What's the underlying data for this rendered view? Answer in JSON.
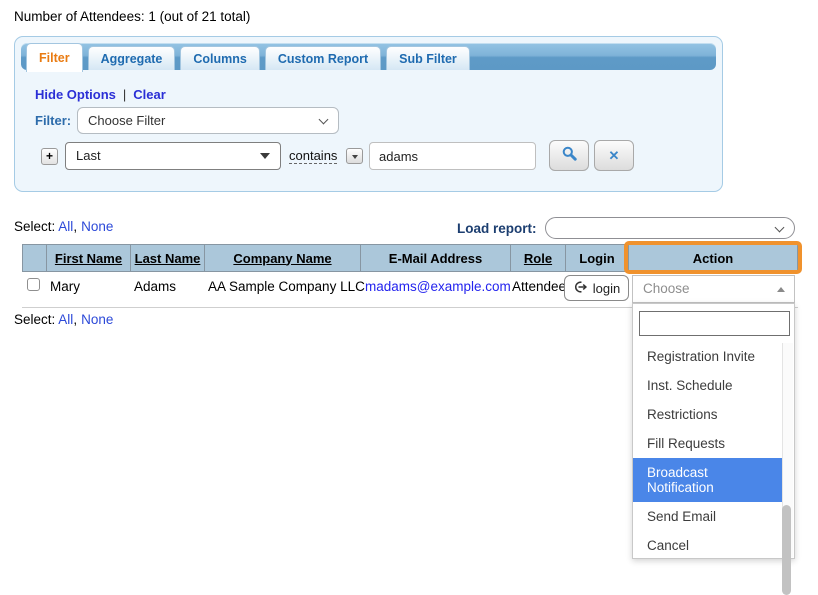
{
  "page": {
    "title": "Number of Attendees: 1 (out of 21 total)"
  },
  "filter_panel": {
    "tabs": [
      {
        "label": "Filter",
        "active": true
      },
      {
        "label": "Aggregate",
        "active": false
      },
      {
        "label": "Columns",
        "active": false
      },
      {
        "label": "Custom Report",
        "active": false
      },
      {
        "label": "Sub Filter",
        "active": false
      }
    ],
    "hide_options_label": "Hide Options",
    "links_separator": "|",
    "clear_label": "Clear",
    "filter_label": "Filter:",
    "filter_select_value": "Choose Filter",
    "condition_row": {
      "add_button_glyph": "+",
      "field_select_value": "Last",
      "operator_value": "contains",
      "search_input_value": "adams",
      "search_button_icon": "magnifier-icon",
      "clear_button_icon": "x-icon",
      "clear_button_glyph": "✕"
    }
  },
  "select_bar_top": {
    "label": "Select:",
    "all_label": "All",
    "comma": ",",
    "none_label": "None"
  },
  "load_report": {
    "label": "Load report:",
    "selected_value": ""
  },
  "table": {
    "headers": [
      {
        "label": ""
      },
      {
        "label": "First Name"
      },
      {
        "label": "Last Name"
      },
      {
        "label": "Company Name"
      },
      {
        "label": "E-Mail Address"
      },
      {
        "label": "Role"
      },
      {
        "label": "Login"
      },
      {
        "label": "Action"
      }
    ],
    "rows": [
      {
        "first_name": "Mary",
        "last_name": "Adams",
        "company": "AA Sample Company LLC",
        "email": "madams@example.com",
        "role": "Attendee",
        "login_label": "login",
        "action_value": "Choose"
      }
    ]
  },
  "select_bar_bottom": {
    "label": "Select:",
    "all_label": "All",
    "comma": ",",
    "none_label": "None"
  },
  "action_dropdown": {
    "value": "Choose",
    "search_input_value": "",
    "options": [
      {
        "label": "Registration Invite",
        "highlighted": false
      },
      {
        "label": "Inst. Schedule",
        "highlighted": false
      },
      {
        "label": "Restrictions",
        "highlighted": false
      },
      {
        "label": "Fill Requests",
        "highlighted": false
      },
      {
        "label": "Broadcast Notification",
        "highlighted": true
      },
      {
        "label": "Send Email",
        "highlighted": false
      },
      {
        "label": "Cancel",
        "highlighted": false
      }
    ]
  },
  "colors": {
    "active_tab_text": "#e97b12",
    "tab_text": "#1f6bb0",
    "highlight_orange": "#f0922d",
    "option_highlight_blue": "#4a86e8",
    "table_header_bg": "#abc7da",
    "link_blue": "#2b2fd6",
    "email_link_blue": "#2323ee"
  }
}
